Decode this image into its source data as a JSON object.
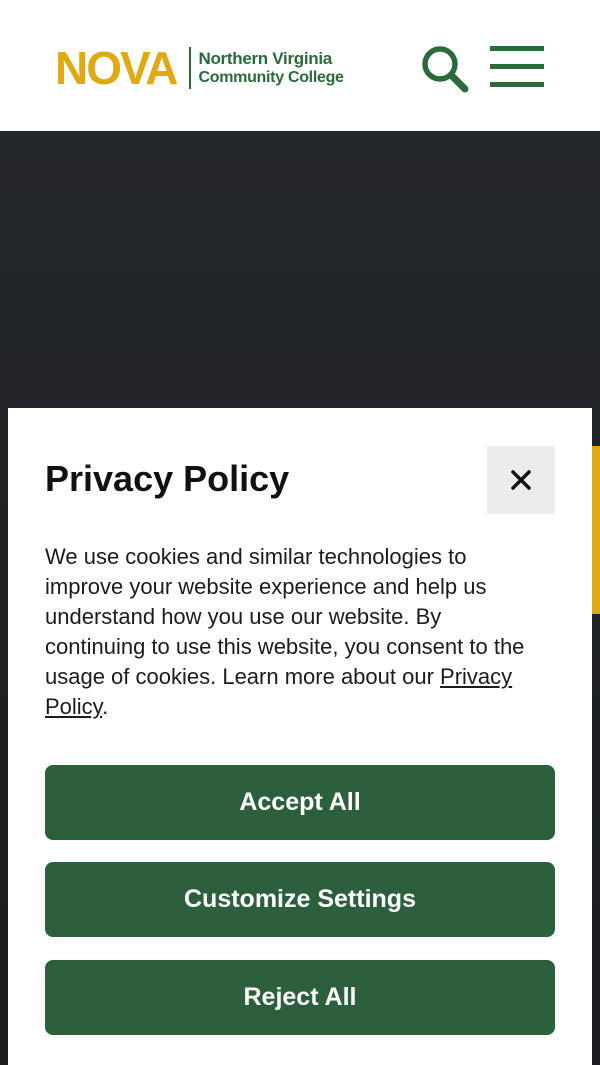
{
  "header": {
    "logo": {
      "wordmark": "NOVA",
      "line1": "Northern Virginia",
      "line2": "Community College"
    },
    "icons": {
      "search": "search-icon",
      "menu": "hamburger-menu-icon"
    }
  },
  "cookie_modal": {
    "title": "Privacy Policy",
    "close_icon": "close-icon",
    "body_text": "We use cookies and similar technologies to improve your website experience and help us understand how you use our website. By continuing to use this website, you consent to the usage of cookies. Learn more about our ",
    "link_text": "Privacy Policy",
    "body_end": ".",
    "buttons": {
      "accept": "Accept All",
      "customize": "Customize Settings",
      "reject": "Reject All"
    }
  },
  "colors": {
    "brand_gold": "#e0a912",
    "brand_green": "#2a6a3b",
    "button_green": "#2c5f3b",
    "hero_dark": "#202326"
  }
}
